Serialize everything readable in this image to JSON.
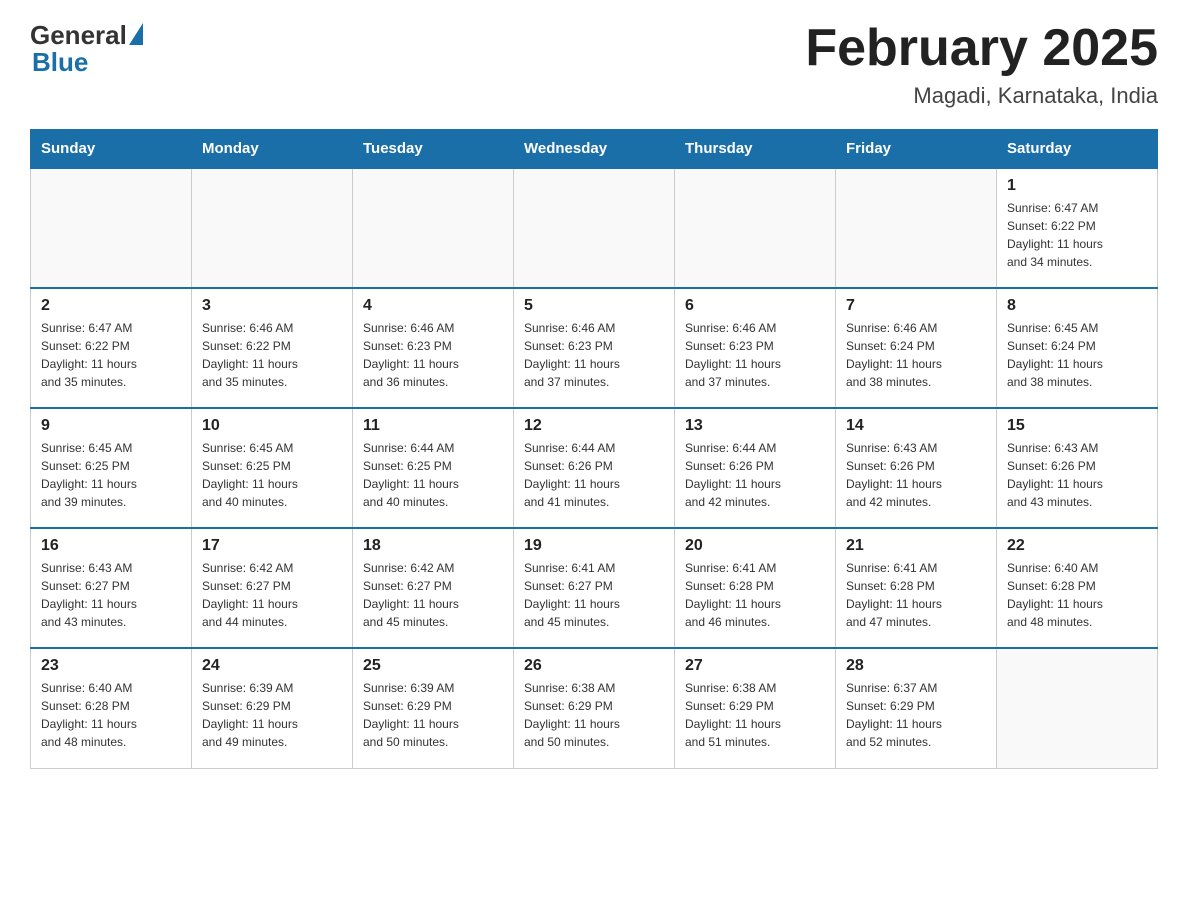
{
  "logo": {
    "general": "General",
    "blue": "Blue"
  },
  "title": {
    "month_year": "February 2025",
    "location": "Magadi, Karnataka, India"
  },
  "weekdays": [
    "Sunday",
    "Monday",
    "Tuesday",
    "Wednesday",
    "Thursday",
    "Friday",
    "Saturday"
  ],
  "weeks": [
    [
      {
        "day": "",
        "info": ""
      },
      {
        "day": "",
        "info": ""
      },
      {
        "day": "",
        "info": ""
      },
      {
        "day": "",
        "info": ""
      },
      {
        "day": "",
        "info": ""
      },
      {
        "day": "",
        "info": ""
      },
      {
        "day": "1",
        "info": "Sunrise: 6:47 AM\nSunset: 6:22 PM\nDaylight: 11 hours\nand 34 minutes."
      }
    ],
    [
      {
        "day": "2",
        "info": "Sunrise: 6:47 AM\nSunset: 6:22 PM\nDaylight: 11 hours\nand 35 minutes."
      },
      {
        "day": "3",
        "info": "Sunrise: 6:46 AM\nSunset: 6:22 PM\nDaylight: 11 hours\nand 35 minutes."
      },
      {
        "day": "4",
        "info": "Sunrise: 6:46 AM\nSunset: 6:23 PM\nDaylight: 11 hours\nand 36 minutes."
      },
      {
        "day": "5",
        "info": "Sunrise: 6:46 AM\nSunset: 6:23 PM\nDaylight: 11 hours\nand 37 minutes."
      },
      {
        "day": "6",
        "info": "Sunrise: 6:46 AM\nSunset: 6:23 PM\nDaylight: 11 hours\nand 37 minutes."
      },
      {
        "day": "7",
        "info": "Sunrise: 6:46 AM\nSunset: 6:24 PM\nDaylight: 11 hours\nand 38 minutes."
      },
      {
        "day": "8",
        "info": "Sunrise: 6:45 AM\nSunset: 6:24 PM\nDaylight: 11 hours\nand 38 minutes."
      }
    ],
    [
      {
        "day": "9",
        "info": "Sunrise: 6:45 AM\nSunset: 6:25 PM\nDaylight: 11 hours\nand 39 minutes."
      },
      {
        "day": "10",
        "info": "Sunrise: 6:45 AM\nSunset: 6:25 PM\nDaylight: 11 hours\nand 40 minutes."
      },
      {
        "day": "11",
        "info": "Sunrise: 6:44 AM\nSunset: 6:25 PM\nDaylight: 11 hours\nand 40 minutes."
      },
      {
        "day": "12",
        "info": "Sunrise: 6:44 AM\nSunset: 6:26 PM\nDaylight: 11 hours\nand 41 minutes."
      },
      {
        "day": "13",
        "info": "Sunrise: 6:44 AM\nSunset: 6:26 PM\nDaylight: 11 hours\nand 42 minutes."
      },
      {
        "day": "14",
        "info": "Sunrise: 6:43 AM\nSunset: 6:26 PM\nDaylight: 11 hours\nand 42 minutes."
      },
      {
        "day": "15",
        "info": "Sunrise: 6:43 AM\nSunset: 6:26 PM\nDaylight: 11 hours\nand 43 minutes."
      }
    ],
    [
      {
        "day": "16",
        "info": "Sunrise: 6:43 AM\nSunset: 6:27 PM\nDaylight: 11 hours\nand 43 minutes."
      },
      {
        "day": "17",
        "info": "Sunrise: 6:42 AM\nSunset: 6:27 PM\nDaylight: 11 hours\nand 44 minutes."
      },
      {
        "day": "18",
        "info": "Sunrise: 6:42 AM\nSunset: 6:27 PM\nDaylight: 11 hours\nand 45 minutes."
      },
      {
        "day": "19",
        "info": "Sunrise: 6:41 AM\nSunset: 6:27 PM\nDaylight: 11 hours\nand 45 minutes."
      },
      {
        "day": "20",
        "info": "Sunrise: 6:41 AM\nSunset: 6:28 PM\nDaylight: 11 hours\nand 46 minutes."
      },
      {
        "day": "21",
        "info": "Sunrise: 6:41 AM\nSunset: 6:28 PM\nDaylight: 11 hours\nand 47 minutes."
      },
      {
        "day": "22",
        "info": "Sunrise: 6:40 AM\nSunset: 6:28 PM\nDaylight: 11 hours\nand 48 minutes."
      }
    ],
    [
      {
        "day": "23",
        "info": "Sunrise: 6:40 AM\nSunset: 6:28 PM\nDaylight: 11 hours\nand 48 minutes."
      },
      {
        "day": "24",
        "info": "Sunrise: 6:39 AM\nSunset: 6:29 PM\nDaylight: 11 hours\nand 49 minutes."
      },
      {
        "day": "25",
        "info": "Sunrise: 6:39 AM\nSunset: 6:29 PM\nDaylight: 11 hours\nand 50 minutes."
      },
      {
        "day": "26",
        "info": "Sunrise: 6:38 AM\nSunset: 6:29 PM\nDaylight: 11 hours\nand 50 minutes."
      },
      {
        "day": "27",
        "info": "Sunrise: 6:38 AM\nSunset: 6:29 PM\nDaylight: 11 hours\nand 51 minutes."
      },
      {
        "day": "28",
        "info": "Sunrise: 6:37 AM\nSunset: 6:29 PM\nDaylight: 11 hours\nand 52 minutes."
      },
      {
        "day": "",
        "info": ""
      }
    ]
  ]
}
